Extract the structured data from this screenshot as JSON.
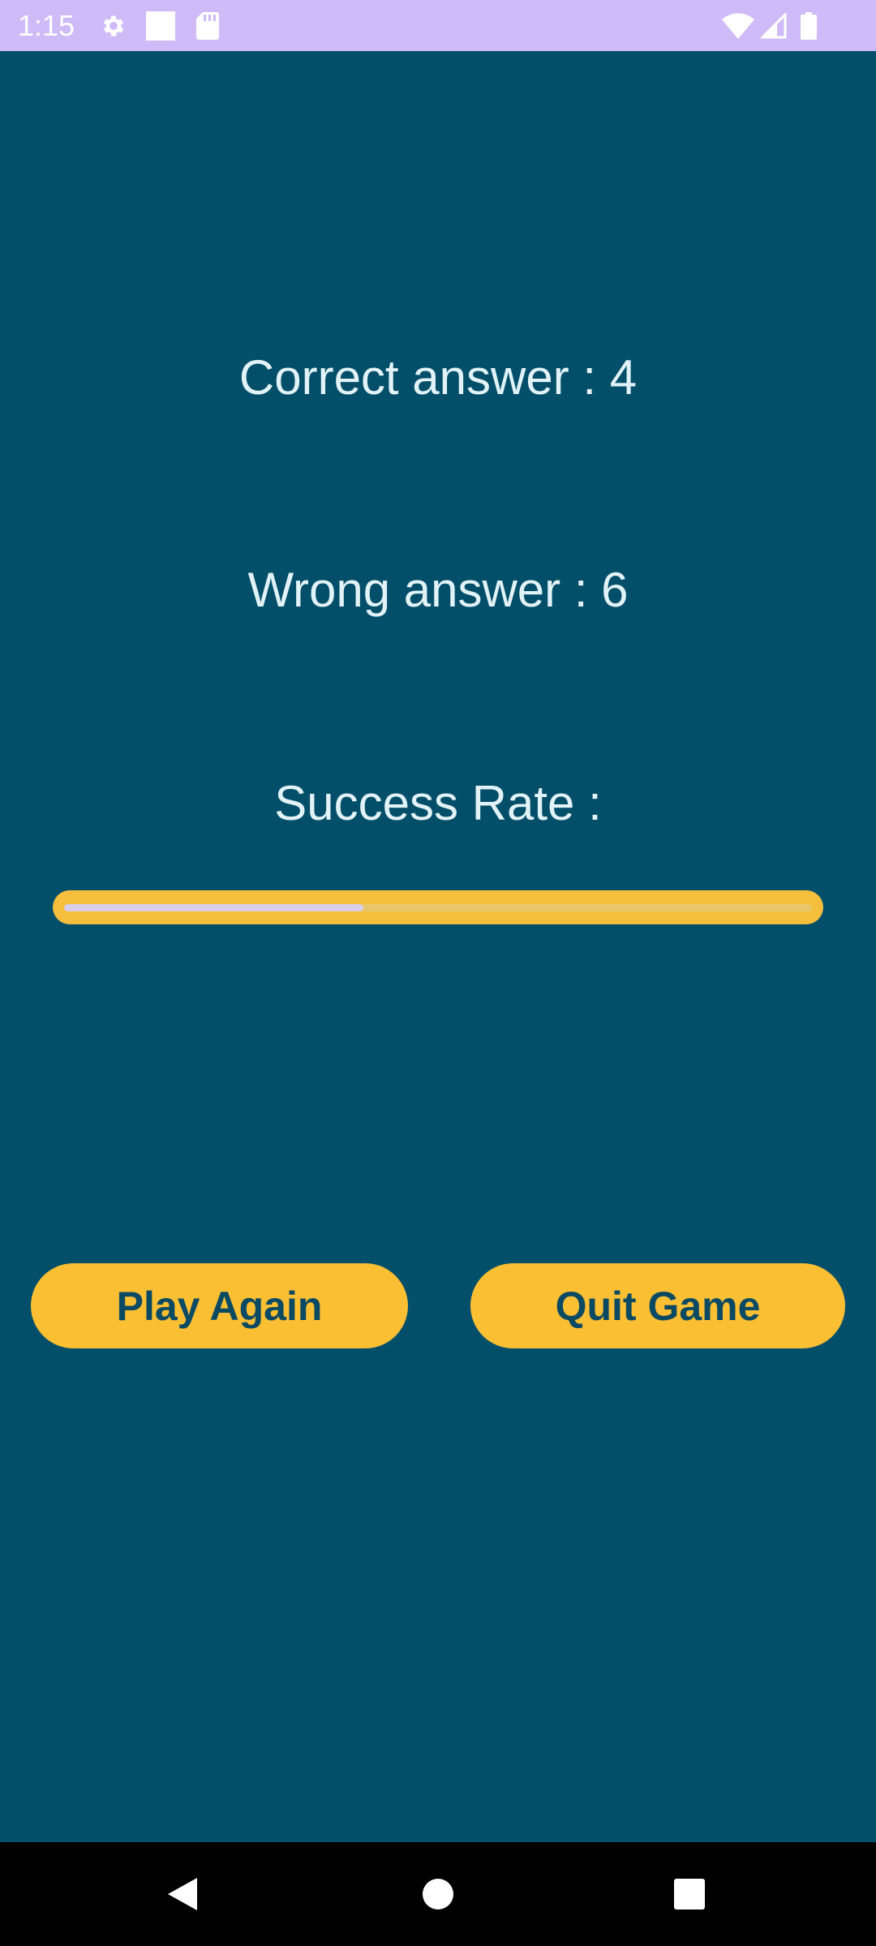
{
  "status_bar": {
    "time": "1:15",
    "background": "#CFBBF7",
    "icons_left": [
      "gear-icon",
      "square-icon",
      "sd-card-icon"
    ],
    "icons_right": [
      "wifi-icon",
      "signal-icon",
      "battery-icon"
    ]
  },
  "results": {
    "correct_label": "Correct answer : 4",
    "wrong_label": "Wrong answer : 6",
    "success_label": "Success Rate :",
    "success_rate_fraction": 0.4
  },
  "buttons": {
    "play_again": "Play Again",
    "quit_game": "Quit Game"
  },
  "colors": {
    "background": "#034F69",
    "accent": "#FBBF33",
    "text": "#E2F3F8",
    "button_text": "#0B4A63"
  },
  "nav_bar": {
    "icons": [
      "back-icon",
      "home-icon",
      "recents-icon"
    ]
  }
}
